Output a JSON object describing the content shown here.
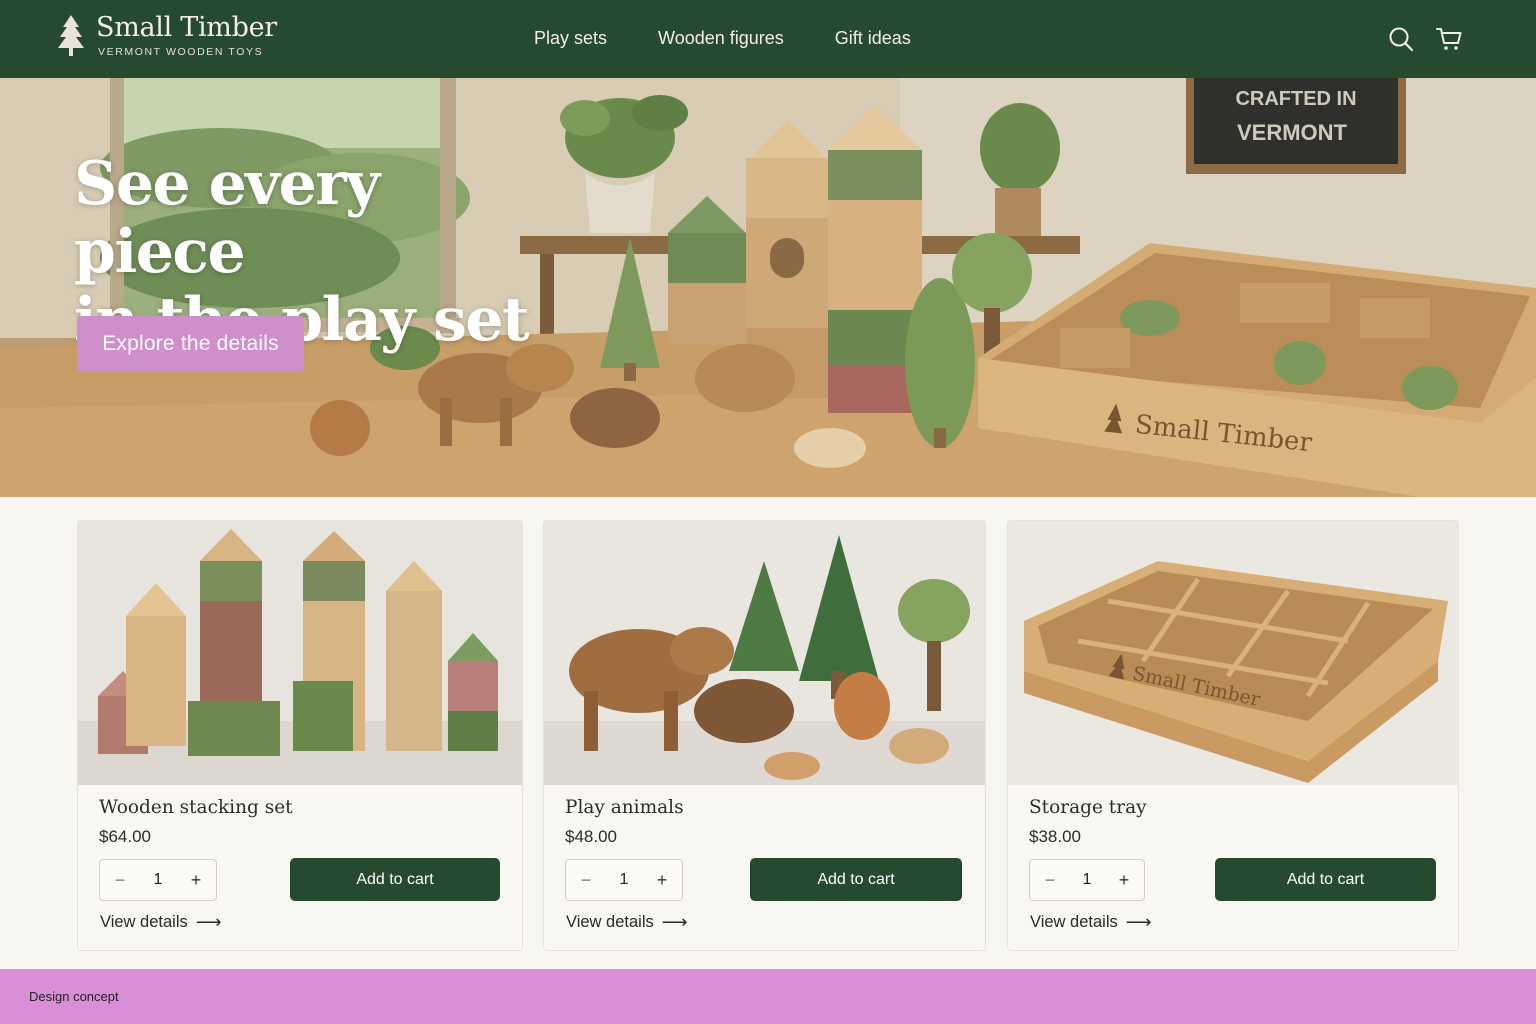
{
  "brand": {
    "name": "Small Timber",
    "tagline": "VERMONT WOODEN TOYS"
  },
  "nav": [
    "Play sets",
    "Wooden figures",
    "Gift ideas"
  ],
  "header_icons": [
    "search-icon",
    "cart-icon"
  ],
  "hero": {
    "title_line1": "See every piece",
    "title_line2": "in the play set",
    "button": "Explore the details",
    "sign_line1": "CRAFTED IN",
    "sign_line2": "VERMONT",
    "tray_engraving": "Small Timber"
  },
  "products": [
    {
      "title": "Wooden stacking set",
      "price": "$64.00",
      "qty": "1",
      "add": "Add to cart",
      "view": "View details"
    },
    {
      "title": "Play animals",
      "price": "$48.00",
      "qty": "1",
      "add": "Add to cart",
      "view": "View details"
    },
    {
      "title": "Storage tray",
      "price": "$38.00",
      "qty": "1",
      "add": "Add to cart",
      "view": "View details",
      "engraving": "Small Timber"
    }
  ],
  "footer": {
    "label": "Design concept"
  },
  "colors": {
    "header": "#264a30",
    "accent_pink": "#cf8ecc",
    "footer": "#d98fd6",
    "button_dark": "#264a30"
  }
}
